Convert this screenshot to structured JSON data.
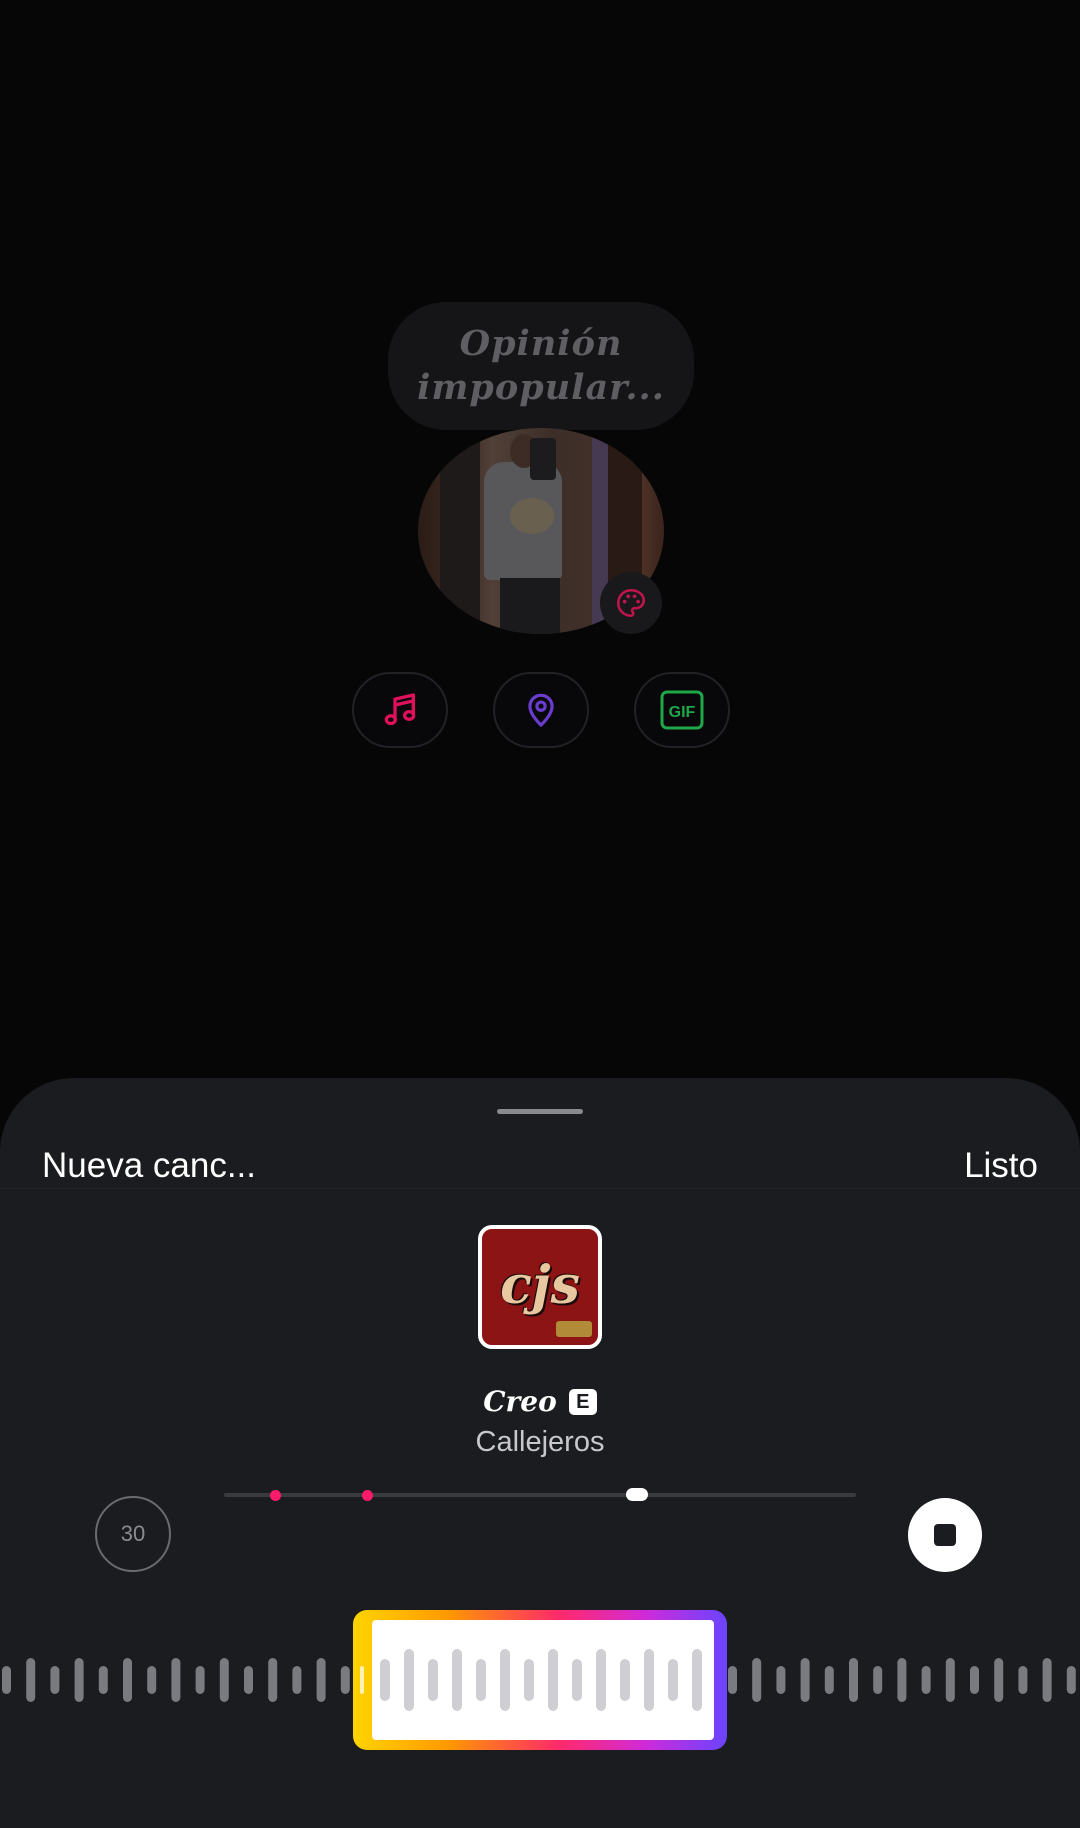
{
  "note": {
    "placeholder_line1": "Opinión",
    "placeholder_line2": "impopular..."
  },
  "avatar": {
    "icon": "palette-icon"
  },
  "toolbar": {
    "buttons": [
      {
        "name": "music",
        "icon": "music-note-icon",
        "color": "#e0105a"
      },
      {
        "name": "location",
        "icon": "location-pin-icon",
        "color": "#6a3cd0"
      },
      {
        "name": "gif",
        "icon": "gif-icon",
        "label": "GIF",
        "color": "#1fa84a"
      }
    ]
  },
  "sheet": {
    "title": "Nueva canc...",
    "done_label": "Listo",
    "song": {
      "title": "Creo",
      "explicit_badge": "E",
      "artist": "Callejeros",
      "album_logo": "cjs"
    },
    "timer_value": "30",
    "stop_icon": "stop-icon",
    "colors": {
      "background": "#1b1c1f",
      "marker": "#ff1a6a",
      "frame_gradient": [
        "#ffd400",
        "#ff2a6a",
        "#6a44ff"
      ]
    }
  }
}
